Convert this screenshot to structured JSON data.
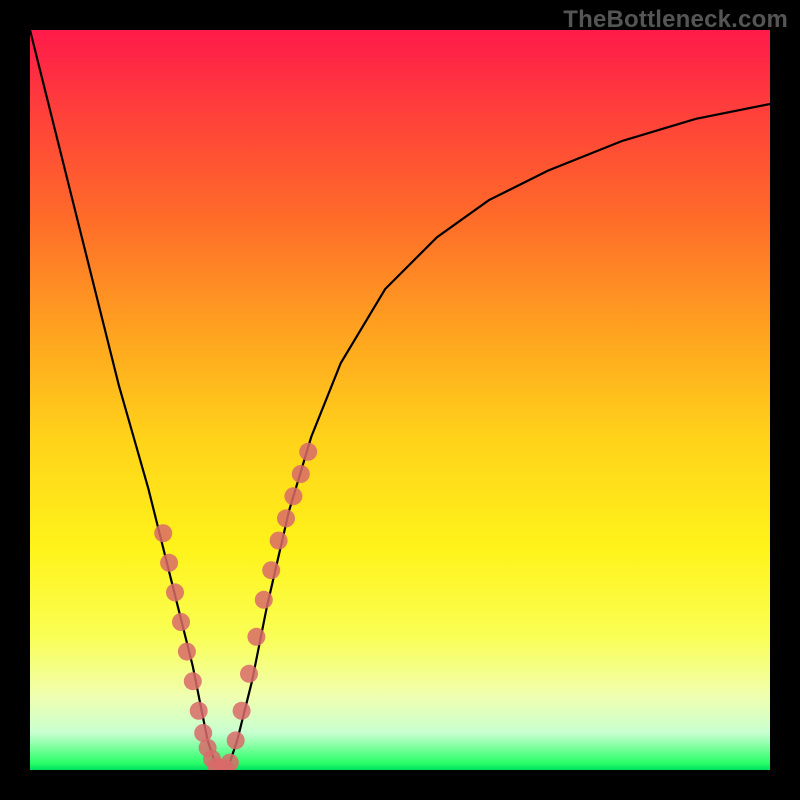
{
  "watermark": "TheBottleneck.com",
  "chart_data": {
    "type": "line",
    "title": "",
    "xlabel": "",
    "ylabel": "",
    "xlim": [
      0,
      100
    ],
    "ylim": [
      0,
      100
    ],
    "grid": false,
    "series": [
      {
        "name": "curve",
        "x": [
          0,
          2,
          4,
          6,
          8,
          10,
          12,
          14,
          16,
          18,
          20,
          22,
          23,
          24,
          25,
          26,
          27,
          28,
          30,
          32,
          35,
          38,
          42,
          48,
          55,
          62,
          70,
          80,
          90,
          100
        ],
        "y": [
          100,
          92,
          84,
          76,
          68,
          60,
          52,
          45,
          38,
          30,
          22,
          14,
          9,
          4,
          1,
          0,
          1,
          4,
          12,
          22,
          35,
          45,
          55,
          65,
          72,
          77,
          81,
          85,
          88,
          90
        ]
      }
    ],
    "markers": [
      {
        "name": "left-dots",
        "x": [
          18,
          18.8,
          19.6,
          20.4,
          21.2,
          22.0,
          22.8,
          23.4,
          24.0,
          24.6,
          25.2,
          25.8,
          26.4
        ],
        "y": [
          32,
          28,
          24,
          20,
          16,
          12,
          8,
          5,
          3,
          1.5,
          0.5,
          0.2,
          0.2
        ]
      },
      {
        "name": "right-dots",
        "x": [
          27.0,
          27.8,
          28.6,
          29.6,
          30.6,
          31.6,
          32.6,
          33.6,
          34.6,
          35.6,
          36.6,
          37.6
        ],
        "y": [
          1,
          4,
          8,
          13,
          18,
          23,
          27,
          31,
          34,
          37,
          40,
          43
        ]
      }
    ],
    "colors": {
      "curve_stroke": "#000000",
      "dot_fill": "#d86a6a",
      "background_top": "#ff1a4a",
      "background_bottom": "#00e060",
      "frame": "#000000"
    }
  }
}
